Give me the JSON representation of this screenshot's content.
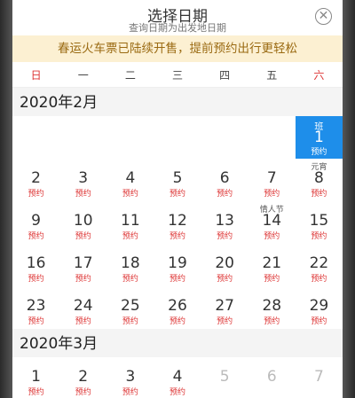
{
  "header": {
    "title": "选择日期",
    "subtitle": "查询日期为出发地日期",
    "close_icon": "ⓧ"
  },
  "banner": {
    "text": "春运火车票已陆续开售，提前预约出行更轻松"
  },
  "weekdays": [
    "日",
    "一",
    "二",
    "三",
    "四",
    "五",
    "六"
  ],
  "months": [
    {
      "title": "2020年2月",
      "weeks": [
        [
          {
            "n": "",
            "top": "",
            "sub": ""
          },
          {
            "n": "",
            "top": "",
            "sub": ""
          },
          {
            "n": "",
            "top": "",
            "sub": ""
          },
          {
            "n": "",
            "top": "",
            "sub": ""
          },
          {
            "n": "",
            "top": "",
            "sub": ""
          },
          {
            "n": "",
            "top": "",
            "sub": ""
          },
          {
            "n": "1",
            "top": "班",
            "sub": "预约",
            "selected": true
          }
        ],
        [
          {
            "n": "2",
            "top": "",
            "sub": "预约"
          },
          {
            "n": "3",
            "top": "",
            "sub": "预约"
          },
          {
            "n": "4",
            "top": "",
            "sub": "预约"
          },
          {
            "n": "5",
            "top": "",
            "sub": "预约"
          },
          {
            "n": "6",
            "top": "",
            "sub": "预约"
          },
          {
            "n": "7",
            "top": "",
            "sub": "预约"
          },
          {
            "n": "8",
            "top": "元宵",
            "sub": "预约"
          }
        ],
        [
          {
            "n": "9",
            "top": "",
            "sub": "预约"
          },
          {
            "n": "10",
            "top": "",
            "sub": "预约"
          },
          {
            "n": "11",
            "top": "",
            "sub": "预约"
          },
          {
            "n": "12",
            "top": "",
            "sub": "预约"
          },
          {
            "n": "13",
            "top": "",
            "sub": "预约"
          },
          {
            "n": "14",
            "top": "情人节",
            "sub": "预约"
          },
          {
            "n": "15",
            "top": "",
            "sub": "预约"
          }
        ],
        [
          {
            "n": "16",
            "top": "",
            "sub": "预约"
          },
          {
            "n": "17",
            "top": "",
            "sub": "预约"
          },
          {
            "n": "18",
            "top": "",
            "sub": "预约"
          },
          {
            "n": "19",
            "top": "",
            "sub": "预约"
          },
          {
            "n": "20",
            "top": "",
            "sub": "预约"
          },
          {
            "n": "21",
            "top": "",
            "sub": "预约"
          },
          {
            "n": "22",
            "top": "",
            "sub": "预约"
          }
        ],
        [
          {
            "n": "23",
            "top": "",
            "sub": "预约"
          },
          {
            "n": "24",
            "top": "",
            "sub": "预约"
          },
          {
            "n": "25",
            "top": "",
            "sub": "预约"
          },
          {
            "n": "26",
            "top": "",
            "sub": "预约"
          },
          {
            "n": "27",
            "top": "",
            "sub": "预约"
          },
          {
            "n": "28",
            "top": "",
            "sub": "预约"
          },
          {
            "n": "29",
            "top": "",
            "sub": "预约"
          }
        ]
      ]
    },
    {
      "title": "2020年3月",
      "weeks": [
        [
          {
            "n": "1",
            "top": "",
            "sub": "预约"
          },
          {
            "n": "2",
            "top": "",
            "sub": "预约"
          },
          {
            "n": "3",
            "top": "",
            "sub": "预约"
          },
          {
            "n": "4",
            "top": "",
            "sub": "预约"
          },
          {
            "n": "5",
            "top": "",
            "sub": "",
            "disabled": true
          },
          {
            "n": "6",
            "top": "",
            "sub": "",
            "disabled": true
          },
          {
            "n": "7",
            "top": "",
            "sub": "",
            "disabled": true
          }
        ]
      ]
    }
  ],
  "colors": {
    "accent": "#1e8eea",
    "weekend": "#d33333",
    "banner_bg": "#fcf0d2",
    "banner_text": "#9a6a12"
  }
}
